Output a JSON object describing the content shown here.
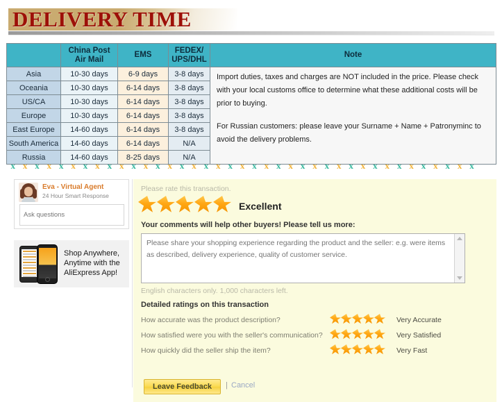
{
  "banner": {
    "title": "DELIVERY TIME",
    "band_color": "#c9ab70",
    "title_color": "#9d1008"
  },
  "delivery_table": {
    "columns": [
      "",
      "China Post Air Mail",
      "EMS",
      "FEDEX/ UPS/DHL",
      "Note"
    ],
    "headers": {
      "region": "",
      "china_post_line1": "China Post",
      "china_post_line2": "Air Mail",
      "ems": "EMS",
      "fedex_line1": "FEDEX/",
      "fedex_line2": "UPS/DHL",
      "note": "Note"
    },
    "rows": [
      {
        "region": "Asia",
        "china_post": "10-30 days",
        "ems": "6-9 days",
        "fedex": "3-8 days"
      },
      {
        "region": "Oceania",
        "china_post": "10-30 days",
        "ems": "6-14 days",
        "fedex": "3-8 days"
      },
      {
        "region": "US/CA",
        "china_post": "10-30 days",
        "ems": "6-14 days",
        "fedex": "3-8 days"
      },
      {
        "region": "Europe",
        "china_post": "10-30 days",
        "ems": "6-14 days",
        "fedex": "3-8 days"
      },
      {
        "region": "East Europe",
        "china_post": "14-60 days",
        "ems": "6-14 days",
        "fedex": "3-8 days"
      },
      {
        "region": "South America",
        "china_post": "14-60 days",
        "ems": "6-14 days",
        "fedex": "N/A"
      },
      {
        "region": "Russia",
        "china_post": "14-60 days",
        "ems": "8-25 days",
        "fedex": "N/A"
      }
    ],
    "note_paragraphs": [
      "Import duties, taxes and charges are NOT included in the price. Please check with your local customs office to determine what these additional costs will be prior to buying.",
      "For Russian customers: please leave your Surname + Name + Patronyminc to avoid the delivery problems."
    ],
    "colors": {
      "header_bg": "#3fb4c6",
      "region_bg": "#c2d6e7",
      "china_post_bg": "#eaf3f7",
      "ems_bg": "#fcf0dd",
      "fedex_bg": "#e4ecf2",
      "note_bg": "#f7f7f7"
    }
  },
  "divider": {
    "glyph": "x",
    "count": 39,
    "color_a": "#3ab9a0",
    "color_b": "#f2b43c"
  },
  "sidebar": {
    "eva": {
      "name": "Eva - Virtual Agent",
      "subtitle": "24 Hour Smart Response",
      "input_placeholder": "Ask questions",
      "input_value": ""
    },
    "app_promo": {
      "text": "Shop Anywhere, Anytime with the AliExpress App!"
    }
  },
  "feedback": {
    "prompt": "Please rate this transaction.",
    "overall_stars": 5,
    "overall_label": "Excellent",
    "comments_prompt": "Your comments will help other buyers! Please tell us more:",
    "textarea_placeholder": "Please share your shopping experience regarding the product and the seller: e.g. were items as described, delivery experience, quality of customer service.",
    "textarea_value": "",
    "char_note": "English characters only. 1,000 characters left.",
    "detailed_title": "Detailed ratings on this transaction",
    "detailed": [
      {
        "question": "How accurate was the product description?",
        "stars": 5,
        "label": "Very Accurate"
      },
      {
        "question": "How satisfied were you with the seller's communication?",
        "stars": 5,
        "label": "Very Satisfied"
      },
      {
        "question": "How quickly did the seller ship the item?",
        "stars": 5,
        "label": "Very Fast"
      }
    ],
    "submit_label": "Leave Feedback",
    "separator": "|",
    "cancel_label": "Cancel",
    "panel_bg": "#fbfbde",
    "star_color": "#ffa714"
  }
}
